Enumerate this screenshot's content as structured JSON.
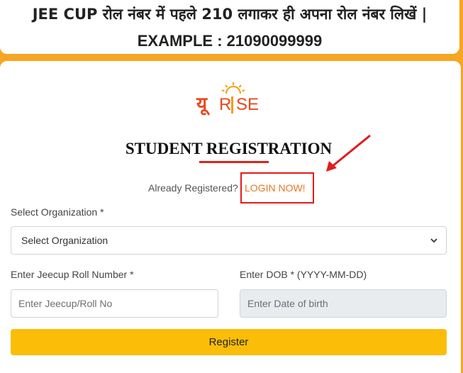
{
  "banner": {
    "line1": "JEE CUP रोल नंबर में पहले 210 लगाकर ही अपना रोल नंबर लिखें |",
    "line2": "EXAMPLE : 21090099999"
  },
  "logo": {
    "text_a": "यू",
    "text_b": "R",
    "text_c": "SE",
    "icon": "sun-logo"
  },
  "form": {
    "title": "STUDENT REGISTRATION",
    "already_registered": "Already Registered?",
    "login_link": "LOGIN NOW!",
    "org_label": "Select Organization *",
    "org_selected": "Select Organization",
    "roll_label": "Enter Jeecup Roll Number *",
    "roll_placeholder": "Enter Jeecup/Roll No",
    "dob_label": "Enter DOB * (YYYY-MM-DD)",
    "dob_placeholder": "Enter Date of birth",
    "register_label": "Register"
  },
  "colors": {
    "background": "#f5a623",
    "accent": "#fbbd08",
    "link": "#e87722",
    "highlight": "#e31b1b"
  }
}
